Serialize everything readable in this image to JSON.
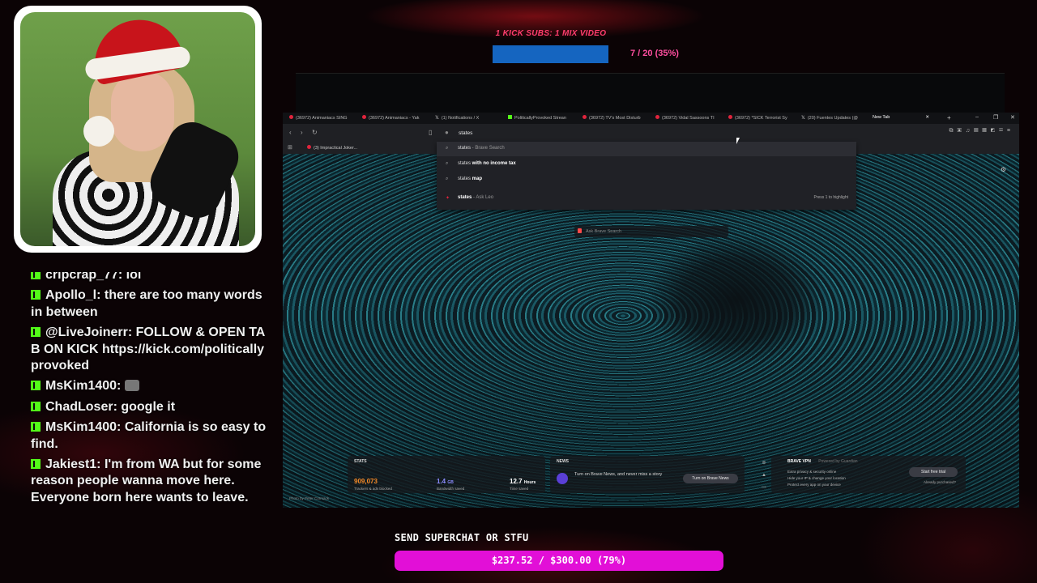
{
  "overlay": {
    "sub_goal_title": "1 KICK SUBS: 1 MIX VIDEO",
    "sub_goal_progress": 0.35,
    "sub_goal_count": "7 / 20 (35%)",
    "donation_heading": "SEND SUPERCHAT OR STFU",
    "donation_progress_text": "$237.52 / $300.00 (79%)",
    "donation_progress": 0.79,
    "colors": {
      "donation_bar": "#e20fd7",
      "sub_bar": "#1565c0",
      "kick_green": "#53fc18"
    }
  },
  "chat": {
    "messages": [
      {
        "user": "cripcrap_77",
        "text": "lol"
      },
      {
        "user": "Apollo_l",
        "text": "there are too many words in between"
      },
      {
        "user": "@LiveJoinerr",
        "text": "FOLLOW & OPEN TAB ON KICK https://kick.com/politicallyprovoked"
      },
      {
        "user": "MsKim1400",
        "text": ""
      },
      {
        "user": "ChadLoser",
        "text": "google it"
      },
      {
        "user": "MsKim1400",
        "text": "California is so easy to find."
      },
      {
        "user": "Jakiest1",
        "text": "I'm from WA but for some reason people wanna move here. Everyone born here wants to leave."
      }
    ]
  },
  "browser": {
    "tabs": [
      {
        "label": "(36972) Animaniacs SING",
        "icon": "youtube-icon"
      },
      {
        "label": "(36972) Animaniacs - Yak",
        "icon": "youtube-icon"
      },
      {
        "label": "(1) Notifications / X",
        "icon": "x-icon"
      },
      {
        "label": "PoliticallyProvoked Strean",
        "icon": "kick-icon"
      },
      {
        "label": "(36972) TV's Most Disturb",
        "icon": "youtube-icon"
      },
      {
        "label": "(36972) Vidal Sassoons TI",
        "icon": "youtube-icon"
      },
      {
        "label": "(36972) *SICK Terrorist Sy",
        "icon": "youtube-icon"
      },
      {
        "label": "(20) Fuentes Updates (@",
        "icon": "x-icon"
      },
      {
        "label": "New Tab",
        "icon": ""
      }
    ],
    "address_text": "states",
    "bookmark": "(3) Impractical Joker...",
    "suggestions": [
      {
        "query": "states",
        "bold": "",
        "suffix": " - Brave Search",
        "icon": "search-icon",
        "hint": ""
      },
      {
        "query": "states",
        "bold": " with no income tax",
        "suffix": "",
        "icon": "search-icon",
        "hint": ""
      },
      {
        "query": "states",
        "bold": " map",
        "suffix": "",
        "icon": "search-icon",
        "hint": ""
      },
      {
        "query": "states",
        "bold": "",
        "suffix": " - Ask Leo",
        "icon": "leo-icon",
        "hint": "Press 1 to highlight"
      }
    ],
    "ask_placeholder": "Ask Brave Search",
    "stats": {
      "label": "STATS",
      "trackers": "909,073",
      "trackers_label": "Trackers & ads blocked",
      "bandwidth": "1.4",
      "bandwidth_unit": "GB",
      "bandwidth_label": "Bandwidth saved",
      "time": "12.7",
      "time_unit": "Hours",
      "time_label": "Time saved"
    },
    "news": {
      "label": "NEWS",
      "text": "Turn on Brave News, and never miss a story",
      "button": "Turn on Brave News"
    },
    "vpn": {
      "title": "BRAVE VPN",
      "powered": "Powered by Guardian",
      "items": [
        "Extra privacy & security online",
        "Hide your IP & change your location",
        "Protect every app on your device"
      ],
      "button": "Start free trial",
      "sub": "Already purchased?"
    },
    "photo_credit": "Photo by Peter Cormack"
  }
}
